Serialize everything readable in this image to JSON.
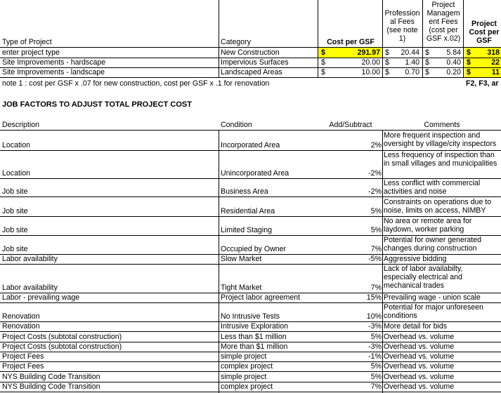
{
  "header": {
    "type_of_project": "Type of Project",
    "category": "Category",
    "cost_per_gsf": "Cost per GSF",
    "professional_fees": "Profession al Fees (see note 1)",
    "pm_fees": "Project Managem ent Fees (cost per GSF x.02)",
    "project_cost": "Project Cost per GSF"
  },
  "projects": [
    {
      "type": "enter project type",
      "category": "New Construction",
      "cost_sym": "$",
      "cost": "291.97",
      "fee_sym": "$",
      "fee": "20.44",
      "pm_sym": "$",
      "pm": "5.84",
      "total_sym": "$",
      "total": "318"
    },
    {
      "type": "Site Improvements - hardscape",
      "category": "Impervious Surfaces",
      "cost_sym": "$",
      "cost": "20.00",
      "fee_sym": "$",
      "fee": "1.40",
      "pm_sym": "$",
      "pm": "0.40",
      "total_sym": "$",
      "total": "22"
    },
    {
      "type": "Site Improvements - landscape",
      "category": "Landscaped Areas",
      "cost_sym": "$",
      "cost": "10.00",
      "fee_sym": "$",
      "fee": "0.70",
      "pm_sym": "$",
      "pm": "0.20",
      "total_sym": "$",
      "total": "11"
    }
  ],
  "note": "note 1 : cost per GSF x .07 for new construction, cost per GSF x .1 for renovation",
  "note_ref": "F2, F3, ar",
  "section_title": "JOB FACTORS TO ADJUST TOTAL PROJECT COST",
  "factor_headers": {
    "description": "Description",
    "condition": "Condition",
    "add_subtract": "Add/Subtract",
    "comments": "Comments"
  },
  "factors": [
    {
      "description": "Location",
      "condition": "Incorporated Area",
      "value": "2%",
      "comments": "More frequent inspection and oversight by village/city inspectors"
    },
    {
      "description": "Location",
      "condition": "Unincorporated Area",
      "value": "-2%",
      "comments": "Less frequency of inspection than in small villages and municipalities"
    },
    {
      "description": "Job site",
      "condition": "Business Area",
      "value": "-2%",
      "comments": "Less conflict with commercial activities and noise"
    },
    {
      "description": "Job site",
      "condition": "Residential Area",
      "value": "5%",
      "comments": "Constraints on operations due to noise, limits on access, NIMBY"
    },
    {
      "description": "Job site",
      "condition": "Limited Staging",
      "value": "5%",
      "comments": "No area or remote area for laydown, worker parking"
    },
    {
      "description": "Job site",
      "condition": "Occupied by Owner",
      "value": "7%",
      "comments": "Potential for owner generated changes during construction"
    },
    {
      "description": "Labor availability",
      "condition": "Slow Market",
      "value": "-5%",
      "comments": "Aggressive bidding"
    },
    {
      "description": "Labor availability",
      "condition": "Tight Market",
      "value": "7%",
      "comments": "Lack of labor availabilty, especially electrical and mechanical trades"
    },
    {
      "description": "Labor - prevailing wage",
      "condition": "Project labor agreement",
      "value": "15%",
      "comments": "Prevailing wage - union scale"
    },
    {
      "description": "Renovation",
      "condition": "No Intrusive Tests",
      "value": "10%",
      "comments": "Potential for major unforeseen conditions"
    },
    {
      "description": "Renovation",
      "condition": "Intrusive Exploration",
      "value": "-3%",
      "comments": "More detail for bids"
    },
    {
      "description": "Project Costs (subtotal construction)",
      "condition": "Less than $1 million",
      "value": "5%",
      "comments": "Overhead vs. volume"
    },
    {
      "description": "Project Costs (subtotal construction)",
      "condition": "More than $1 million",
      "value": "-3%",
      "comments": "Overhead vs. volume"
    },
    {
      "description": "Project Fees",
      "condition": "simple project",
      "value": "-1%",
      "comments": "Overhead vs. volume"
    },
    {
      "description": "Project Fees",
      "condition": "complex project",
      "value": "5%",
      "comments": "Overhead vs. volume"
    },
    {
      "description": "NYS Building Code Transition",
      "condition": "simple project",
      "value": "5%",
      "comments": "Overhead vs. volume"
    },
    {
      "description": "NYS Building Code Transition",
      "condition": "complex project",
      "value": "7%",
      "comments": "Overhead vs. volume"
    }
  ]
}
